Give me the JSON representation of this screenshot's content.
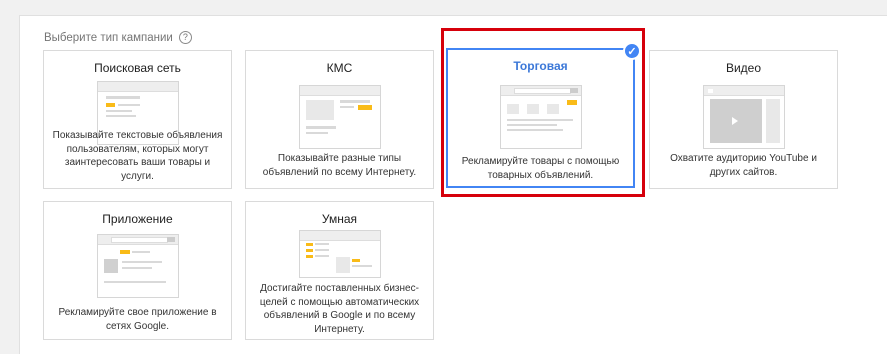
{
  "page": {
    "heading": "Выберите тип кампании",
    "help_icon": "?"
  },
  "campaign_types": [
    {
      "id": "search",
      "title": "Поисковая сеть",
      "description": "Показывайте текстовые объявления пользователям, которых могут заинтересовать ваши товары и услуги.",
      "selected": false
    },
    {
      "id": "display",
      "title": "КМС",
      "description": "Показывайте разные типы объявлений по всему Интернету.",
      "selected": false
    },
    {
      "id": "shopping",
      "title": "Торговая",
      "description": "Рекламируйте товары с помощью товарных объявлений.",
      "selected": true
    },
    {
      "id": "video",
      "title": "Видео",
      "description": "Охватите аудиторию YouTube и других сайтов.",
      "selected": false
    },
    {
      "id": "app",
      "title": "Приложение",
      "description": "Рекламируйте свое приложение в сетях Google.",
      "selected": false
    },
    {
      "id": "smart",
      "title": "Умная",
      "description": "Достигайте поставленных бизнес-целей с помощью автоматических объявлений в Google и по всему Интернету.",
      "selected": false
    }
  ],
  "colors": {
    "selected_border": "#4285f4",
    "selected_title": "#3c78d8",
    "highlight": "#d6000b",
    "accent_yellow": "#f9bb18"
  }
}
